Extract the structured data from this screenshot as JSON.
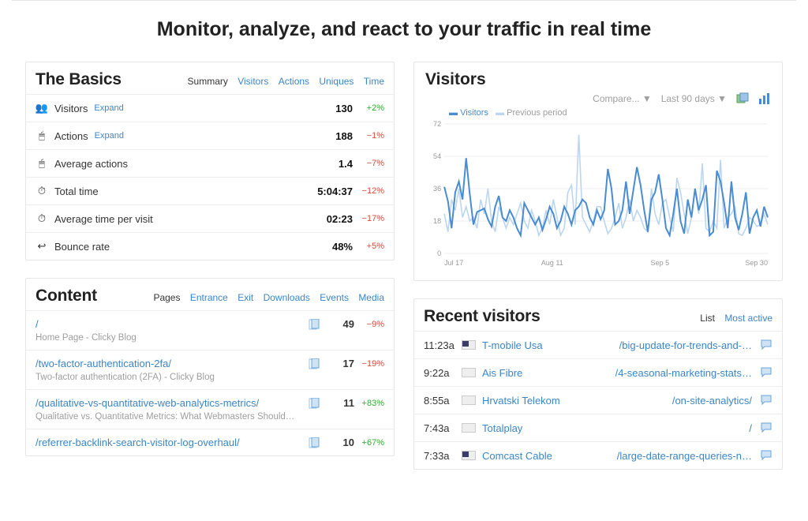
{
  "title": "Monitor, analyze, and react to your traffic in real time",
  "basics": {
    "heading": "The Basics",
    "tabs": [
      "Summary",
      "Visitors",
      "Actions",
      "Uniques",
      "Time"
    ],
    "active_tab": "Summary",
    "expand_label": "Expand",
    "rows": [
      {
        "icon": "visitors",
        "label": "Visitors",
        "expand": true,
        "value": "130",
        "delta": "+2%",
        "dir": "up"
      },
      {
        "icon": "actions",
        "label": "Actions",
        "expand": true,
        "value": "188",
        "delta": "−1%",
        "dir": "down"
      },
      {
        "icon": "avg-actions",
        "label": "Average actions",
        "expand": false,
        "value": "1.4",
        "delta": "−7%",
        "dir": "down"
      },
      {
        "icon": "total-time",
        "label": "Total time",
        "expand": false,
        "value": "5:04:37",
        "delta": "−12%",
        "dir": "down"
      },
      {
        "icon": "avg-time",
        "label": "Average time per visit",
        "expand": false,
        "value": "02:23",
        "delta": "−17%",
        "dir": "down"
      },
      {
        "icon": "bounce",
        "label": "Bounce rate",
        "expand": false,
        "value": "48%",
        "delta": "+5%",
        "dir": "down"
      }
    ]
  },
  "content": {
    "heading": "Content",
    "tabs": [
      "Pages",
      "Entrance",
      "Exit",
      "Downloads",
      "Events",
      "Media"
    ],
    "active_tab": "Pages",
    "rows": [
      {
        "path": "/",
        "sub": "Home Page - Clicky Blog",
        "count": "49",
        "delta": "−9%",
        "dir": "down"
      },
      {
        "path": "/two-factor-authentication-2fa/",
        "sub": "Two-factor authentication (2FA) - Clicky Blog",
        "count": "17",
        "delta": "−19%",
        "dir": "down"
      },
      {
        "path": "/qualitative-vs-quantitative-web-analytics-metrics/",
        "sub": "Qualitative vs. Quantitative Metrics: What Webmasters Should…",
        "count": "11",
        "delta": "+83%",
        "dir": "up"
      },
      {
        "path": "/referrer-backlink-search-visitor-log-overhaul/",
        "sub": "",
        "count": "10",
        "delta": "+67%",
        "dir": "up"
      }
    ]
  },
  "visitors_panel": {
    "heading": "Visitors",
    "controls": {
      "compare": "Compare... ▼",
      "range": "Last 90 days ▼"
    },
    "legend": {
      "series1": "Visitors",
      "series2": "Previous period"
    }
  },
  "chart_data": {
    "type": "line",
    "xlabel": "",
    "ylabel": "",
    "ylim": [
      0,
      72
    ],
    "y_ticks": [
      0,
      18,
      36,
      54,
      72
    ],
    "x_ticks": [
      "Jul 17",
      "Aug 11",
      "Sep 5",
      "Sep 30"
    ],
    "series": [
      {
        "name": "Visitors",
        "color": "#4a8cd1",
        "values": [
          37,
          29,
          14,
          34,
          40,
          30,
          53,
          33,
          16,
          23,
          24,
          25,
          19,
          15,
          26,
          32,
          20,
          18,
          24,
          20,
          14,
          10,
          28,
          24,
          20,
          16,
          20,
          13,
          19,
          26,
          22,
          14,
          18,
          26,
          22,
          16,
          24,
          26,
          30,
          28,
          20,
          16,
          24,
          19,
          24,
          47,
          36,
          16,
          18,
          24,
          40,
          22,
          35,
          48,
          38,
          24,
          12,
          30,
          34,
          44,
          30,
          14,
          10,
          22,
          36,
          18,
          11,
          30,
          20,
          36,
          24,
          30,
          38,
          10,
          12,
          46,
          40,
          28,
          14,
          40,
          20,
          13,
          22,
          34,
          11,
          20,
          24,
          15,
          26,
          20
        ]
      },
      {
        "name": "Previous period",
        "color": "#bcd6ef",
        "values": [
          22,
          12,
          30,
          24,
          36,
          20,
          26,
          18,
          20,
          14,
          30,
          22,
          36,
          18,
          12,
          26,
          20,
          14,
          20,
          16,
          22,
          28,
          18,
          14,
          24,
          18,
          10,
          14,
          24,
          16,
          30,
          20,
          10,
          14,
          34,
          38,
          16,
          66,
          20,
          16,
          12,
          18,
          26,
          26,
          18,
          11,
          14,
          20,
          28,
          14,
          20,
          30,
          18,
          24,
          20,
          14,
          12,
          36,
          22,
          16,
          28,
          30,
          20,
          12,
          42,
          34,
          22,
          11,
          20,
          36,
          22,
          50,
          14,
          12,
          18,
          14,
          52,
          14,
          20,
          22,
          26,
          11,
          10,
          14,
          20,
          18,
          15,
          16,
          22,
          16
        ]
      }
    ]
  },
  "recent": {
    "heading": "Recent visitors",
    "tabs": [
      "List",
      "Most active"
    ],
    "active_tab": "List",
    "rows": [
      {
        "time": "11:23a",
        "flag": "us",
        "isp": "T-mobile Usa",
        "page": "/big-update-for-trends-and-…"
      },
      {
        "time": "9:22a",
        "flag": "th",
        "isp": "Ais Fibre",
        "page": "/4-seasonal-marketing-stats…"
      },
      {
        "time": "8:55a",
        "flag": "hr",
        "isp": "Hrvatski Telekom",
        "page": "/on-site-analytics/"
      },
      {
        "time": "7:43a",
        "flag": "mx",
        "isp": "Totalplay",
        "page": "/"
      },
      {
        "time": "7:33a",
        "flag": "us",
        "isp": "Comcast Cable",
        "page": "/large-date-range-queries-n…"
      }
    ]
  }
}
